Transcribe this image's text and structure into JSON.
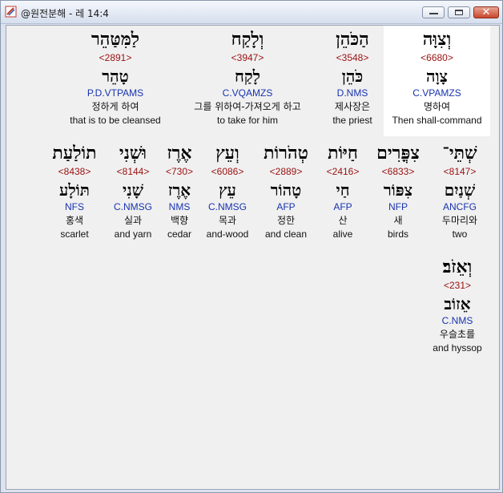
{
  "window": {
    "title": "@원전분해 - 레 14:4",
    "buttons": {
      "minimize": "minimize",
      "maximize": "maximize",
      "close": "✕"
    }
  },
  "words": [
    {
      "hebrew": "וְצִוָּה",
      "strong": "<6680>",
      "lemma": "צָוָה",
      "morph": "C.VPAMZS",
      "korean": "명하여",
      "english": "Then shall-command"
    },
    {
      "hebrew": "הַכֹּהֵן",
      "strong": "<3548>",
      "lemma": "כֹּהֵן",
      "morph": "D.NMS",
      "korean": "제사장은",
      "english": "the priest"
    },
    {
      "hebrew": "וְלָקַח",
      "strong": "<3947>",
      "lemma": "לָקַח",
      "morph": "C.VQAMZS",
      "korean": "그를 위하여-가져오게 하고",
      "english": "to take for him"
    },
    {
      "hebrew": "לַמִּטַּהֵר",
      "strong": "<2891>",
      "lemma": "טָהֵר",
      "morph": "P.D.VTPAMS",
      "korean": "정하게 하여",
      "english": "that is to be cleansed"
    },
    {
      "hebrew": "שְׁתֵּי־",
      "strong": "<8147>",
      "lemma": "שְׁנַיִם",
      "morph": "ANCFG",
      "korean": "두마리와",
      "english": "two"
    },
    {
      "hebrew": "צִפֳּרִים",
      "strong": "<6833>",
      "lemma": "צִפּוֹר",
      "morph": "NFP",
      "korean": "새",
      "english": "birds"
    },
    {
      "hebrew": "חַיּוֹת",
      "strong": "<2416>",
      "lemma": "חַי",
      "morph": "AFP",
      "korean": "산",
      "english": "alive"
    },
    {
      "hebrew": "טְהֹרוֹת",
      "strong": "<2889>",
      "lemma": "טָהוֹר",
      "morph": "AFP",
      "korean": "정한",
      "english": "and clean"
    },
    {
      "hebrew": "וְעֵץ",
      "strong": "<6086>",
      "lemma": "עֵץ",
      "morph": "C.NMSG",
      "korean": "목과",
      "english": "and-wood"
    },
    {
      "hebrew": "אֶרֶז",
      "strong": "<730>",
      "lemma": "אֶרֶז",
      "morph": "NMS",
      "korean": "백향",
      "english": "cedar"
    },
    {
      "hebrew": "וּשְׁנִי",
      "strong": "<8144>",
      "lemma": "שָׁנִי",
      "morph": "C.NMSG",
      "korean": "실과",
      "english": "and yarn"
    },
    {
      "hebrew": "תוֹלַעַת",
      "strong": "<8438>",
      "lemma": "תּוֹלָע",
      "morph": "NFS",
      "korean": "홍색",
      "english": "scarlet"
    },
    {
      "hebrew": "וְאֵזֹב׃",
      "strong": "<231>",
      "lemma": "אֵזוֹב",
      "morph": "C.NMS",
      "korean": "우슬초를",
      "english": "and hyssop"
    }
  ]
}
